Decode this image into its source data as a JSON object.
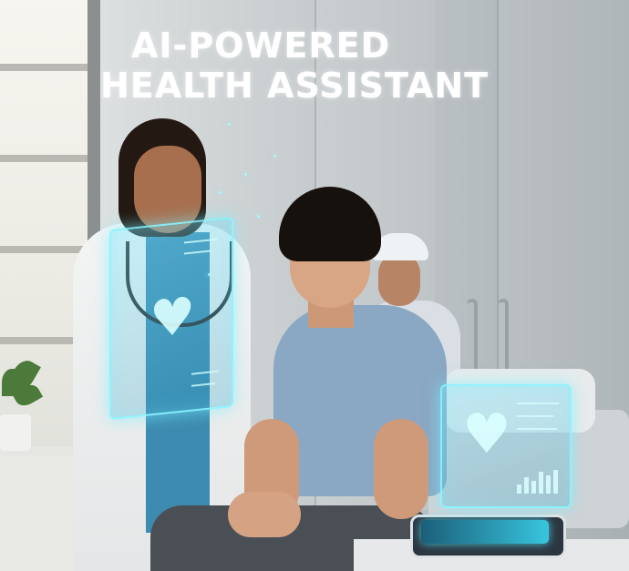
{
  "headline": {
    "line1": "AI-POWERED",
    "line2": "HEALTH ASSISTANT"
  },
  "colors": {
    "title_text": "#ffffff",
    "hologram_glow": "#8cf5ff",
    "scrubs": "#3d8bb0",
    "patient_shirt": "#8aa7c3"
  },
  "scene": {
    "subjects": [
      "doctor",
      "patient",
      "nurse"
    ],
    "icons": [
      "hologram-heart-icon",
      "hologram-chart-icon"
    ]
  }
}
